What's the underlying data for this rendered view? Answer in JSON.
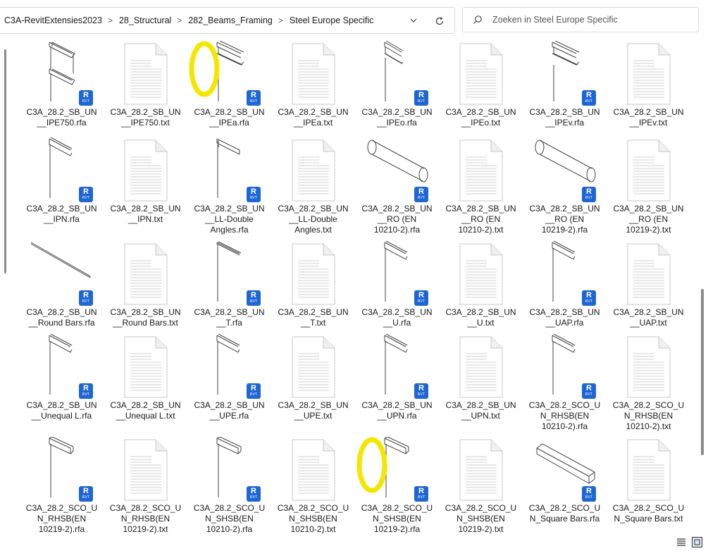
{
  "address": {
    "crumbs": [
      "C3A-RevitExtensies2023",
      "28_Structural",
      "282_Beams_Framing",
      "Steel Europe Specific"
    ],
    "separator": ">"
  },
  "search": {
    "placeholder": "Zoeken in Steel Europe Specific"
  },
  "files": [
    {
      "lines": [
        "C3A_28.2_SB_UN",
        "__IPE750.rfa"
      ],
      "kind": "rfa",
      "shape": "ibeam"
    },
    {
      "lines": [
        "C3A_28.2_SB_UN",
        "__IPE750.txt"
      ],
      "kind": "txt"
    },
    {
      "lines": [
        "C3A_28.2_SB_UN",
        "__IPEa.rfa"
      ],
      "kind": "rfa",
      "shape": "ibeam-small"
    },
    {
      "lines": [
        "C3A_28.2_SB_UN",
        "__IPEa.txt"
      ],
      "kind": "txt"
    },
    {
      "lines": [
        "C3A_28.2_SB_UN",
        "__IPEo.rfa"
      ],
      "kind": "rfa",
      "shape": "ibeam-thin"
    },
    {
      "lines": [
        "C3A_28.2_SB_UN",
        "__IPEo.txt"
      ],
      "kind": "txt"
    },
    {
      "lines": [
        "C3A_28.2_SB_UN",
        "__IPEv.rfa"
      ],
      "kind": "rfa",
      "shape": "ibeam-small"
    },
    {
      "lines": [
        "C3A_28.2_SB_UN",
        "__IPEv.txt"
      ],
      "kind": "txt"
    },
    {
      "lines": [
        "C3A_28.2_SB_UN",
        "__IPN.rfa"
      ],
      "kind": "rfa",
      "shape": "channel"
    },
    {
      "lines": [
        "C3A_28.2_SB_UN",
        "__IPN.txt"
      ],
      "kind": "txt"
    },
    {
      "lines": [
        "C3A_28.2_SB_UN",
        "__LL-Double",
        "Angles.rfa"
      ],
      "kind": "rfa",
      "shape": "angle"
    },
    {
      "lines": [
        "C3A_28.2_SB_UN",
        "__LL-Double",
        "Angles.txt"
      ],
      "kind": "txt"
    },
    {
      "lines": [
        "C3A_28.2_SB_UN",
        "__RO (EN",
        "10210-2).rfa"
      ],
      "kind": "rfa",
      "shape": "tube"
    },
    {
      "lines": [
        "C3A_28.2_SB_UN",
        "__RO (EN",
        "10210-2).txt"
      ],
      "kind": "txt"
    },
    {
      "lines": [
        "C3A_28.2_SB_UN",
        "__RO (EN",
        "10219-2).rfa"
      ],
      "kind": "rfa",
      "shape": "tube"
    },
    {
      "lines": [
        "C3A_28.2_SB_UN",
        "__RO (EN",
        "10219-2).txt"
      ],
      "kind": "txt"
    },
    {
      "lines": [
        "C3A_28.2_SB_UN",
        "__Round Bars.rfa"
      ],
      "kind": "rfa",
      "shape": "rod"
    },
    {
      "lines": [
        "C3A_28.2_SB_UN",
        "__Round Bars.txt"
      ],
      "kind": "txt"
    },
    {
      "lines": [
        "C3A_28.2_SB_UN",
        "__T.rfa"
      ],
      "kind": "rfa",
      "shape": "tee"
    },
    {
      "lines": [
        "C3A_28.2_SB_UN",
        "__T.txt"
      ],
      "kind": "txt"
    },
    {
      "lines": [
        "C3A_28.2_SB_UN",
        "__U.rfa"
      ],
      "kind": "rfa",
      "shape": "channel"
    },
    {
      "lines": [
        "C3A_28.2_SB_UN",
        "__U.txt"
      ],
      "kind": "txt"
    },
    {
      "lines": [
        "C3A_28.2_SB_UN",
        "__UAP.rfa"
      ],
      "kind": "rfa",
      "shape": "channel"
    },
    {
      "lines": [
        "C3A_28.2_SB_UN",
        "__UAP.txt"
      ],
      "kind": "txt"
    },
    {
      "lines": [
        "C3A_28.2_SB_UN",
        "__Unequal L.rfa"
      ],
      "kind": "rfa",
      "shape": "channel"
    },
    {
      "lines": [
        "C3A_28.2_SB_UN",
        "__Unequal L.txt"
      ],
      "kind": "txt"
    },
    {
      "lines": [
        "C3A_28.2_SB_UN",
        "__UPE.rfa"
      ],
      "kind": "rfa",
      "shape": "channel"
    },
    {
      "lines": [
        "C3A_28.2_SB_UN",
        "__UPE.txt"
      ],
      "kind": "txt"
    },
    {
      "lines": [
        "C3A_28.2_SB_UN",
        "__UPN.rfa"
      ],
      "kind": "rfa",
      "shape": "channel"
    },
    {
      "lines": [
        "C3A_28.2_SB_UN",
        "__UPN.txt"
      ],
      "kind": "txt"
    },
    {
      "lines": [
        "C3A_28.2_SCO_U",
        "N_RHSB(EN",
        "10210-2).rfa"
      ],
      "kind": "rfa",
      "shape": "channel"
    },
    {
      "lines": [
        "C3A_28.2_SCO_U",
        "N_RHSB(EN",
        "10210-2).txt"
      ],
      "kind": "txt"
    },
    {
      "lines": [
        "C3A_28.2_SCO_U",
        "N_RHSB(EN",
        "10219-2).rfa"
      ],
      "kind": "rfa",
      "shape": "box"
    },
    {
      "lines": [
        "C3A_28.2_SCO_U",
        "N_RHSB(EN",
        "10219-2).txt"
      ],
      "kind": "txt"
    },
    {
      "lines": [
        "C3A_28.2_SCO_U",
        "N_SHSB(EN",
        "10210-2).rfa"
      ],
      "kind": "rfa",
      "shape": "box"
    },
    {
      "lines": [
        "C3A_28.2_SCO_U",
        "N_SHSB(EN",
        "10210-2).txt"
      ],
      "kind": "txt"
    },
    {
      "lines": [
        "C3A_28.2_SCO_U",
        "N_SHSB(EN",
        "10219-2).rfa"
      ],
      "kind": "rfa",
      "shape": "box"
    },
    {
      "lines": [
        "C3A_28.2_SCO_U",
        "N_SHSB(EN",
        "10219-2).txt"
      ],
      "kind": "txt"
    },
    {
      "lines": [
        "C3A_28.2_SCO_U",
        "N_Square Bars.rfa"
      ],
      "kind": "rfa",
      "shape": "bar"
    },
    {
      "lines": [
        "C3A_28.2_SCO_U",
        "N_Square Bars.txt"
      ],
      "kind": "txt"
    }
  ],
  "badge": {
    "text": "R",
    "sub": "RVT",
    "color": "#1e66d3"
  },
  "highlight_color": "#f5e600",
  "highlighted_files": [
    2,
    36
  ]
}
